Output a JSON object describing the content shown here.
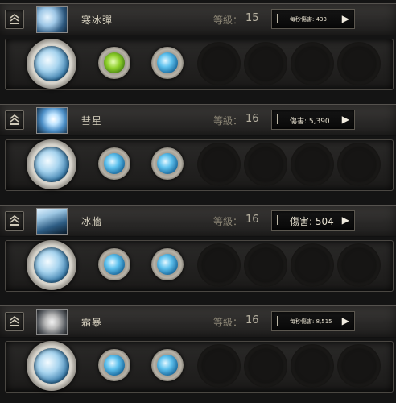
{
  "labels": {
    "level": "等級："
  },
  "skills": [
    {
      "name": "寒冰彈",
      "level": "15",
      "stat": "每秒傷害: 433",
      "icon": "ice-orb-icon",
      "gems": [
        "green",
        "blue"
      ]
    },
    {
      "name": "彗星",
      "level": "16",
      "stat": "傷害: 5,390",
      "icon": "comet-icon",
      "gems": [
        "blue",
        "blue"
      ]
    },
    {
      "name": "冰牆",
      "level": "16",
      "stat": "傷害: 504",
      "icon": "ice-wall-icon",
      "gems": [
        "blue",
        "blue"
      ]
    },
    {
      "name": "霜暴",
      "level": "16",
      "stat": "每秒傷害: 8,515",
      "icon": "frost-storm-icon",
      "gems": [
        "blue",
        "blue"
      ]
    }
  ]
}
